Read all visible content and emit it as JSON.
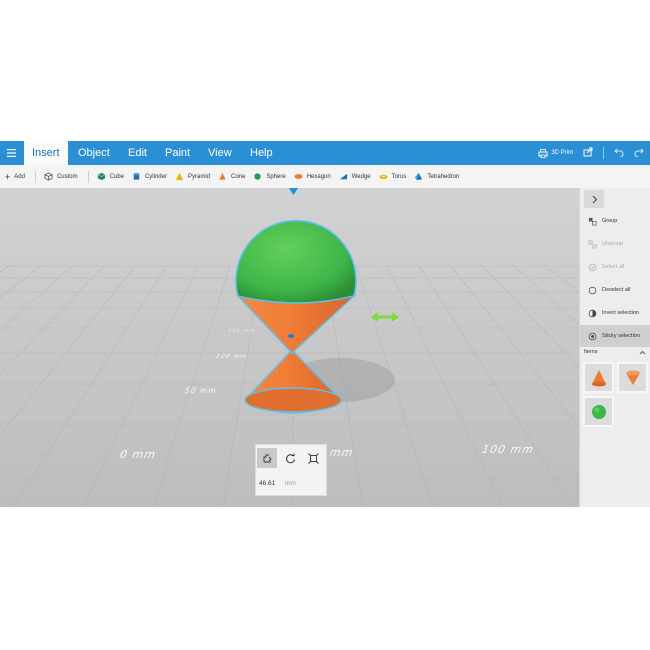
{
  "menu": {
    "tabs": [
      "Insert",
      "Object",
      "Edit",
      "Paint",
      "View",
      "Help"
    ],
    "active_tab": "Insert",
    "print_label": "3D Print"
  },
  "toolbar": {
    "add_label": "Add",
    "custom_label": "Custom",
    "shapes": [
      {
        "label": "Cube",
        "icon": "cube-icon",
        "color": "#1e8a5a"
      },
      {
        "label": "Cylinder",
        "icon": "cylinder-icon",
        "color": "#1f6fb3"
      },
      {
        "label": "Pyramid",
        "icon": "pyramid-icon",
        "color": "#e6b800"
      },
      {
        "label": "Cone",
        "icon": "cone-icon",
        "color": "#ef7a2b"
      },
      {
        "label": "Sphere",
        "icon": "sphere-icon",
        "color": "#1e9a4a"
      },
      {
        "label": "Hexagon",
        "icon": "hexagon-icon",
        "color": "#ef7a2b"
      },
      {
        "label": "Wedge",
        "icon": "wedge-icon",
        "color": "#1f6fb3"
      },
      {
        "label": "Torus",
        "icon": "torus-icon",
        "color": "#e6b800"
      },
      {
        "label": "Tetrahedron",
        "icon": "tetrahedron-icon",
        "color": "#1f6fb3"
      }
    ]
  },
  "viewport": {
    "floor_labels": [
      "150 mm",
      "100 mm",
      "50 mm",
      "0 mm",
      "mm",
      "100 mm"
    ],
    "colors": {
      "sphere": "#3fb64a",
      "cone": "#ef7a35",
      "selection": "#5bc0eb",
      "arrow": "#7ddc3a",
      "indicator": "#1e90d8"
    }
  },
  "gizmo": {
    "value": "46.61",
    "unit": "mm"
  },
  "side_panel": {
    "actions": [
      {
        "label": "Group",
        "icon": "group-icon",
        "enabled": true,
        "active": false
      },
      {
        "label": "Ungroup",
        "icon": "ungroup-icon",
        "enabled": false,
        "active": false
      },
      {
        "label": "Select all",
        "icon": "select-all-icon",
        "enabled": false,
        "active": false
      },
      {
        "label": "Deselect all",
        "icon": "deselect-all-icon",
        "enabled": true,
        "active": false
      },
      {
        "label": "Invert selection",
        "icon": "invert-selection-icon",
        "enabled": true,
        "active": false
      },
      {
        "label": "Sticky selection",
        "icon": "sticky-selection-icon",
        "enabled": true,
        "active": true
      }
    ],
    "items_label": "Items",
    "items": [
      {
        "name": "cone-thumbnail",
        "color": "#ef7a35"
      },
      {
        "name": "inverted-cone-thumbnail",
        "color": "#ef7a35"
      },
      {
        "name": "sphere-thumbnail",
        "color": "#3fb64a"
      }
    ]
  }
}
